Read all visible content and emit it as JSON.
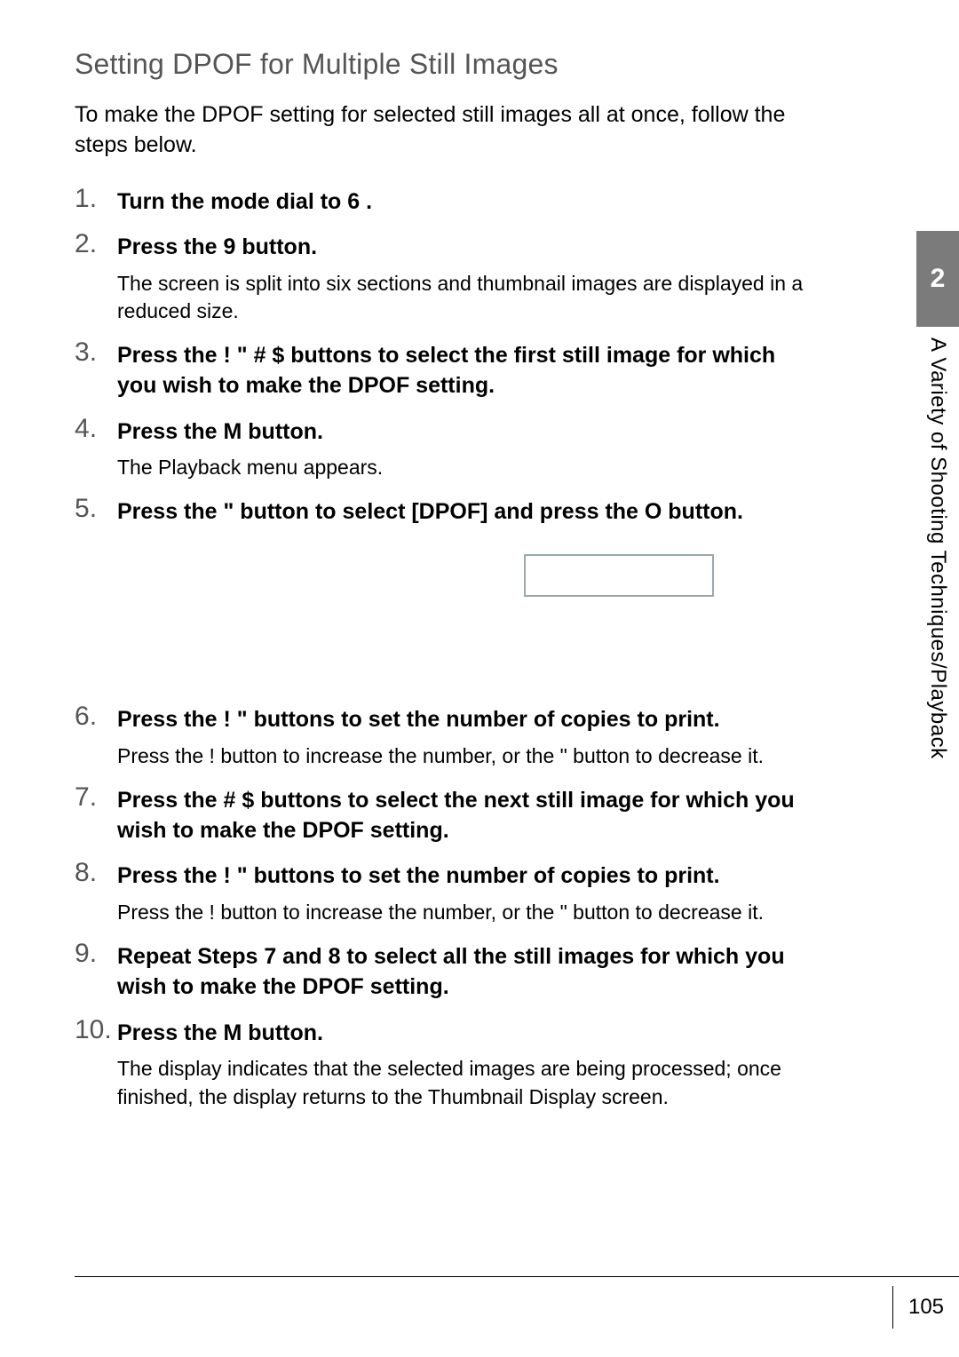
{
  "title": "Setting DPOF for Multiple Still Images",
  "intro": "To make the DPOF setting for selected still images all at once, follow the steps below.",
  "steps": [
    {
      "head": "Turn the mode dial to 6 .",
      "body": ""
    },
    {
      "head": "Press the 9  button.",
      "body": "The screen is split into six sections and thumbnail images are displayed in a reduced size."
    },
    {
      "head": "Press the !  \"  # $  buttons to select the first still image for which you wish to make the DPOF setting.",
      "body": ""
    },
    {
      "head": "Press the M        button.",
      "body": "The Playback menu appears."
    },
    {
      "head": "Press the \"  button to select [DPOF] and press the O   button.",
      "body": "",
      "hasScreenshot": true
    },
    {
      "head": "Press the !  \"   buttons to set the number of copies to print.",
      "body": "Press the !  button to increase the number, or the \"  button to decrease it."
    },
    {
      "head": "Press the # $  buttons to select the next still image for which you wish to make the DPOF setting.",
      "body": ""
    },
    {
      "head": "Press the !  \"   buttons to set the number of copies to print.",
      "body": "Press the !  button to increase the number, or the \"  button to decrease it."
    },
    {
      "head": "Repeat Steps 7 and 8 to select all the still images for which you wish to make the DPOF setting.",
      "body": ""
    },
    {
      "head": "Press the M        button.",
      "body": "The display indicates that the selected images are being processed; once finished, the display returns to the Thumbnail Display screen."
    }
  ],
  "sideTab": "2",
  "sideText": "A Variety of Shooting Techniques/Playback",
  "pageNumber": "105"
}
